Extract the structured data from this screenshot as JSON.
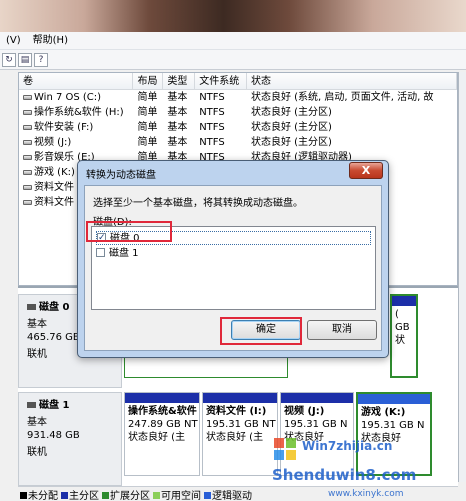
{
  "menu": {
    "items": [
      "(V)",
      "帮助(H)"
    ]
  },
  "toolbar": {
    "buttons": [
      "refresh-icon",
      "export-icon",
      "help-icon"
    ]
  },
  "volume_table": {
    "columns": [
      "卷",
      "布局",
      "类型",
      "文件系统",
      "状态"
    ],
    "rows": [
      {
        "name": "Win 7 OS  (C:)",
        "layout": "简单",
        "type": "基本",
        "fs": "NTFS",
        "status": "状态良好 (系统, 启动, 页面文件, 活动, 故"
      },
      {
        "name": "操作系统&软件 (H:)",
        "layout": "简单",
        "type": "基本",
        "fs": "NTFS",
        "status": "状态良好 (主分区)"
      },
      {
        "name": "软件安装 (F:)",
        "layout": "简单",
        "type": "基本",
        "fs": "NTFS",
        "status": "状态良好 (主分区)"
      },
      {
        "name": "视频 (J:)",
        "layout": "简单",
        "type": "基本",
        "fs": "NTFS",
        "status": "状态良好 (主分区)"
      },
      {
        "name": "影音娱乐 (E:)",
        "layout": "简单",
        "type": "基本",
        "fs": "NTFS",
        "status": "状态良好 (逻辑驱动器)"
      },
      {
        "name": "游戏 (K:)",
        "layout": "",
        "type": "",
        "fs": "",
        "status": ""
      },
      {
        "name": "资料文件",
        "layout": "",
        "type": "",
        "fs": "",
        "status": ""
      },
      {
        "name": "资料文件",
        "layout": "",
        "type": "",
        "fs": "",
        "status": ""
      }
    ]
  },
  "disks": [
    {
      "name": "磁盘 0",
      "type": "基本",
      "size": "465.76 GB",
      "state": "联机"
    },
    {
      "name": "磁盘 1",
      "type": "基本",
      "size": "931.48 GB",
      "state": "联机"
    }
  ],
  "disk0_partitions": [
    {
      "name": "(",
      "size": "GB",
      "status": "状"
    }
  ],
  "disk1_partitions": [
    {
      "name": "操作系统&软件",
      "size": "247.89 GB NT",
      "status": "状态良好 (主"
    },
    {
      "name": "资料文件  (I:)",
      "size": "195.31 GB NT",
      "status": "状态良好 (主"
    },
    {
      "name": "视频  (J:)",
      "size": "195.31 GB N",
      "status": "状态良好"
    },
    {
      "name": "游戏  (K:)",
      "size": "195.31 GB N",
      "status": "状态良好"
    }
  ],
  "legend": [
    {
      "label": "未分配",
      "color": "#000000"
    },
    {
      "label": "主分区",
      "color": "#1c2fa8"
    },
    {
      "label": "扩展分区",
      "color": "#2e8b2e"
    },
    {
      "label": "可用空间",
      "color": "#8ccf5a"
    },
    {
      "label": "逻辑驱动",
      "color": "#2a5fd6"
    }
  ],
  "dialog": {
    "title": "转换为动态磁盘",
    "close": "X",
    "message": "选择至少一个基本磁盘，将其转换成动态磁盘。",
    "list_label": "磁盘(D):",
    "items": [
      {
        "label": "磁盘  0",
        "checked": true
      },
      {
        "label": "磁盘  1",
        "checked": false
      }
    ],
    "ok_label": "确定",
    "cancel_label": "取消"
  },
  "colors": {
    "highlight": "#e0283a",
    "primary_partition": "#1c2fa8",
    "extended_border": "#2e8b2e"
  },
  "watermark": {
    "text1": "Win7zhijia.cn",
    "text2": "Shenduwin8.com",
    "text3": "www.kxinyk.com"
  }
}
